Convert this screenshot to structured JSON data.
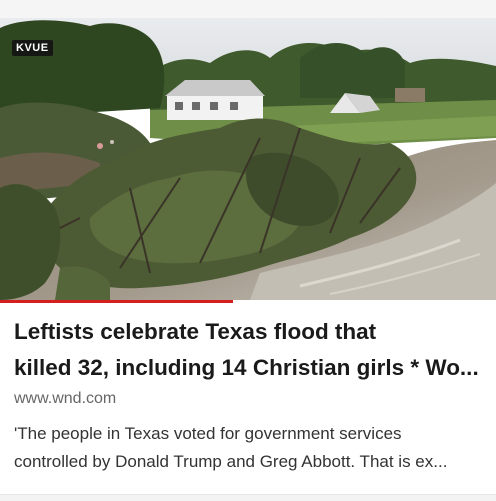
{
  "video": {
    "channel_badge": "KVUE",
    "progress_fraction": 0.47
  },
  "article": {
    "headline_line1": "Leftists celebrate Texas flood that",
    "headline_line2": "killed 32, including 14 Christian girls * Wo...",
    "source": "www.wnd.com",
    "snippet_line1": "'The people in Texas voted for government services",
    "snippet_line2": "controlled by Donald Trump and Greg Abbott. That is ex..."
  },
  "colors": {
    "progress": "#d51f1f",
    "headline": "#1a1a1a",
    "source": "#666666",
    "snippet": "#333333"
  }
}
